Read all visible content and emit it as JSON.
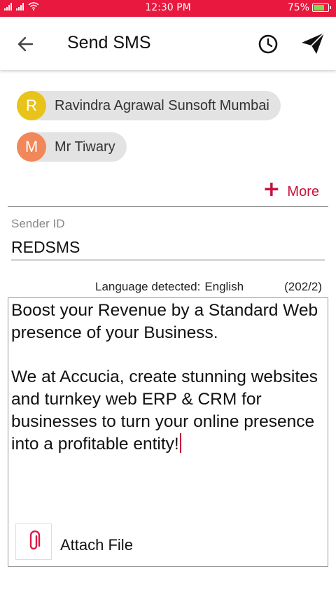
{
  "status_bar": {
    "time": "12:30 PM",
    "battery_percent": "75%",
    "battery_level": 0.75
  },
  "header": {
    "title": "Send SMS",
    "icons": [
      "back-arrow-icon",
      "clock-icon",
      "send-icon"
    ]
  },
  "recipients": [
    {
      "initial": "R",
      "name": "Ravindra Agrawal Sunsoft Mumbai",
      "color": "#e8c41a"
    },
    {
      "initial": "M",
      "name": "Mr Tiwary",
      "color": "#f2875a"
    }
  ],
  "more": {
    "label": "More",
    "icon": "+"
  },
  "sender": {
    "label": "Sender ID",
    "value": "REDSMS"
  },
  "language": {
    "label": "Language detected:",
    "value": "English",
    "counter": "(202/2)"
  },
  "message": {
    "text": "Boost your Revenue by a Standard Web presence of your Business.\n\nWe at Accucia, create stunning websites and turnkey web ERP & CRM for businesses to turn your online presence into a profitable entity!"
  },
  "attach": {
    "label": "Attach File",
    "icon": "paperclip-icon"
  },
  "colors": {
    "accent": "#e8183e",
    "action": "#c8103a",
    "chip_bg": "#e3e3e3"
  }
}
